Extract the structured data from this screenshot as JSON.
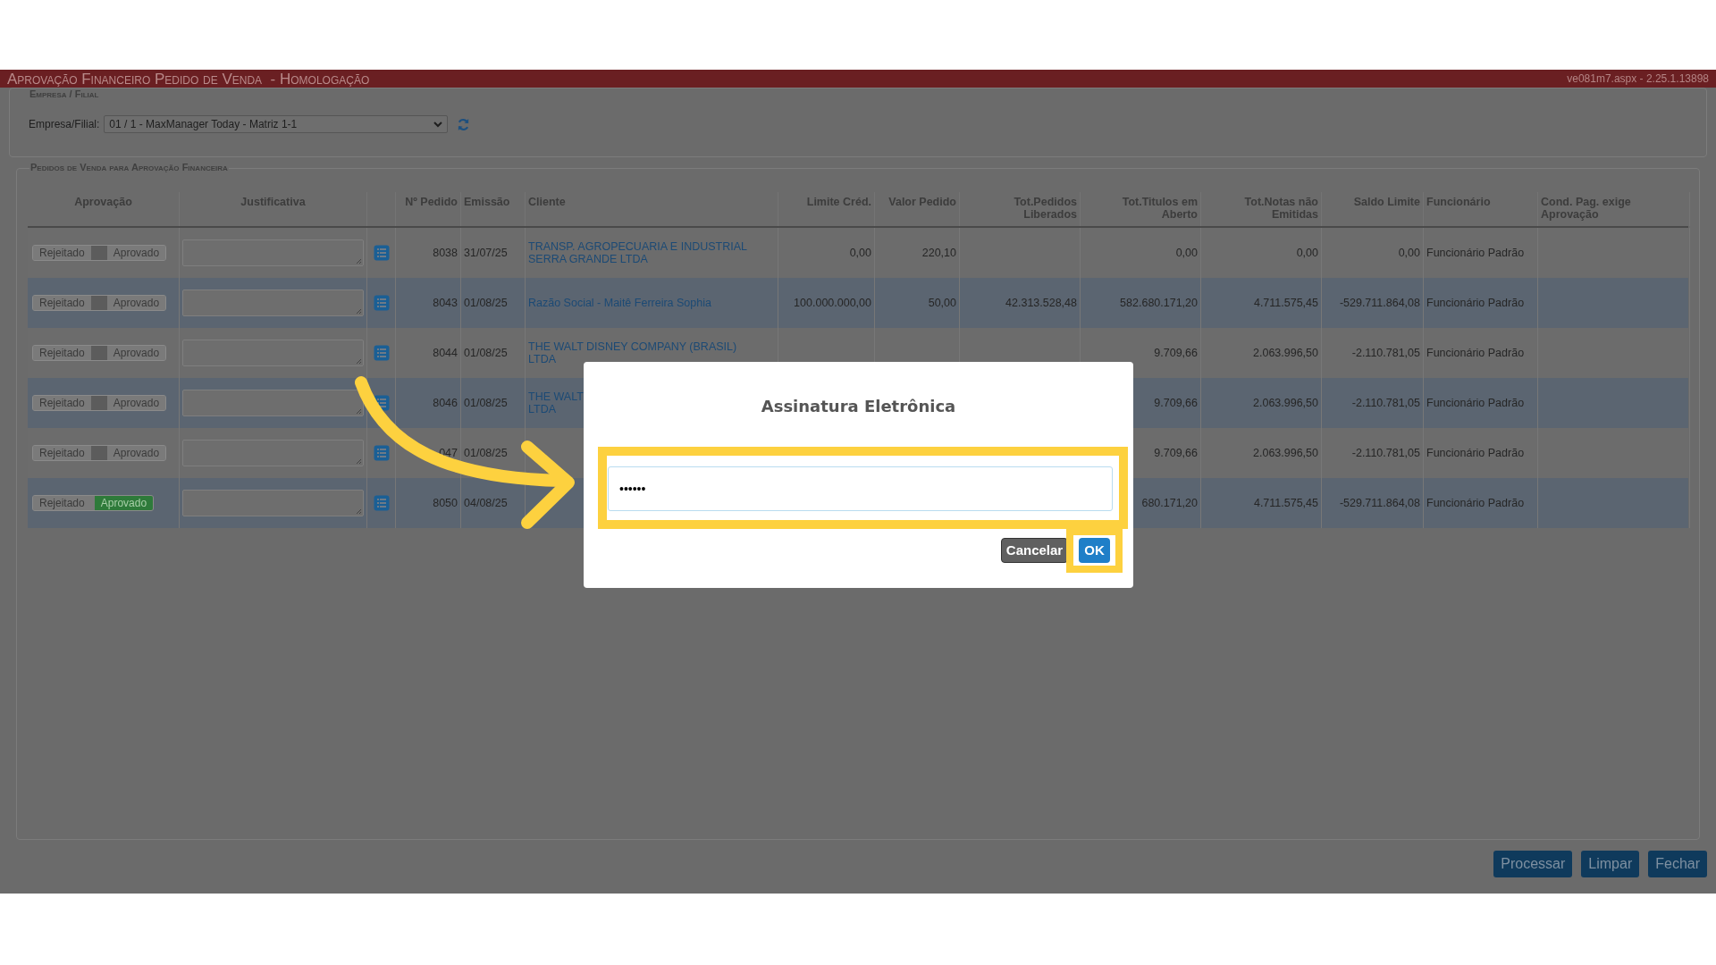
{
  "header": {
    "title": "Aprovação Financeiro Pedido de Venda  - Homologação",
    "version": "ve081m7.aspx - 2.25.1.13898"
  },
  "empresa": {
    "legend": "Empresa / Filial",
    "label": "Empresa/Filial:",
    "value": "01 / 1 - MaxManager Today - Matriz 1-1"
  },
  "pedidos": {
    "legend": "Pedidos de Venda para Aprovação Financeira",
    "columns": [
      {
        "lines": [
          "Aprovação"
        ]
      },
      {
        "lines": [
          "Justificativa"
        ]
      },
      {
        "lines": [
          "Nº Pedido"
        ]
      },
      {
        "lines": [
          "Emissão"
        ]
      },
      {
        "lines": [
          "Cliente"
        ]
      },
      {
        "lines": [
          "Limite Créd."
        ]
      },
      {
        "lines": [
          "Valor Pedido"
        ]
      },
      {
        "lines": [
          "Tot.Pedidos",
          "Liberados"
        ]
      },
      {
        "lines": [
          "Tot.Titulos em",
          "Aberto"
        ]
      },
      {
        "lines": [
          "Tot.Notas não",
          "Emitidas"
        ]
      },
      {
        "lines": [
          "Saldo Limite"
        ]
      },
      {
        "lines": [
          "Funcionário"
        ]
      },
      {
        "lines": [
          "Cond. Pag. exige",
          "Aprovação"
        ]
      }
    ],
    "rows": [
      {
        "options": [
          {
            "label": "Rejeitado",
            "selected": false
          },
          {
            "label": "Aprovado",
            "selected": false
          }
        ],
        "pedido": "8038",
        "emissao": "31/07/25",
        "cliente": [
          "TRANSP. AGROPECUARIA E INDUSTRIAL",
          "SERRA GRANDE LTDA"
        ],
        "limite": "0,00",
        "valor": "220,10",
        "tot_titulos": "0,00",
        "tot_notas": "0,00",
        "saldo": "0,00",
        "funcionario": "Funcionário Padrão"
      },
      {
        "options": [
          {
            "label": "Rejeitado",
            "selected": false
          },
          {
            "label": "Aprovado",
            "selected": false
          }
        ],
        "pedido": "8043",
        "emissao": "01/08/25",
        "cliente": [
          "Razão Social - Maitê Ferreira Sophia"
        ],
        "limite": "100.000.000,00",
        "valor": "50,00",
        "tot_pedidos": "42.313.528,48",
        "tot_titulos": "582.680.171,20",
        "tot_notas": "4.711.575,45",
        "saldo": "-529.711.864,08",
        "funcionario": "Funcionário Padrão"
      },
      {
        "options": [
          {
            "label": "Rejeitado",
            "selected": false
          },
          {
            "label": "Aprovado",
            "selected": false
          }
        ],
        "pedido": "8044",
        "emissao": "01/08/25",
        "cliente": [
          "THE WALT DISNEY COMPANY (BRASIL)",
          "LTDA"
        ],
        "tot_titulos": "9.709,66",
        "tot_notas": "2.063.996,50",
        "saldo": "-2.110.781,05",
        "funcionario": "Funcionário Padrão"
      },
      {
        "options": [
          {
            "label": "Rejeitado",
            "selected": false
          },
          {
            "label": "Aprovado",
            "selected": false
          }
        ],
        "pedido": "8046",
        "emissao": "01/08/25",
        "cliente": [
          "THE WALT",
          "LTDA"
        ],
        "tot_titulos": "9.709,66",
        "tot_notas": "2.063.996,50",
        "saldo": "-2.110.781,05",
        "funcionario": "Funcionário Padrão"
      },
      {
        "options": [
          {
            "label": "Rejeitado",
            "selected": false
          },
          {
            "label": "Aprovado",
            "selected": false
          }
        ],
        "pedido": "047",
        "emissao": "01/08/25",
        "tot_titulos": "9.709,66",
        "tot_notas": "2.063.996,50",
        "saldo": "-2.110.781,05",
        "funcionario": "Funcionário Padrão"
      },
      {
        "options": [
          {
            "label": "Rejeitado",
            "selected": false
          },
          {
            "label": "Aprovado",
            "selected": true
          }
        ],
        "pedido": "8050",
        "emissao": "04/08/25",
        "tot_titulos": "680.171,20",
        "tot_notas": "4.711.575,45",
        "saldo": "-529.711.864,08",
        "funcionario": "Funcionário Padrão"
      }
    ]
  },
  "buttons": [
    "Processar",
    "Limpar",
    "Fechar"
  ],
  "dialog": {
    "title": "Assinatura Eletrônica",
    "password": "••••••",
    "buttons": [
      {
        "label": "Cancelar",
        "kind": "secondary",
        "highlighted": false
      },
      {
        "label": "OK",
        "kind": "primary",
        "highlighted": true
      }
    ],
    "field_highlighted": true
  }
}
